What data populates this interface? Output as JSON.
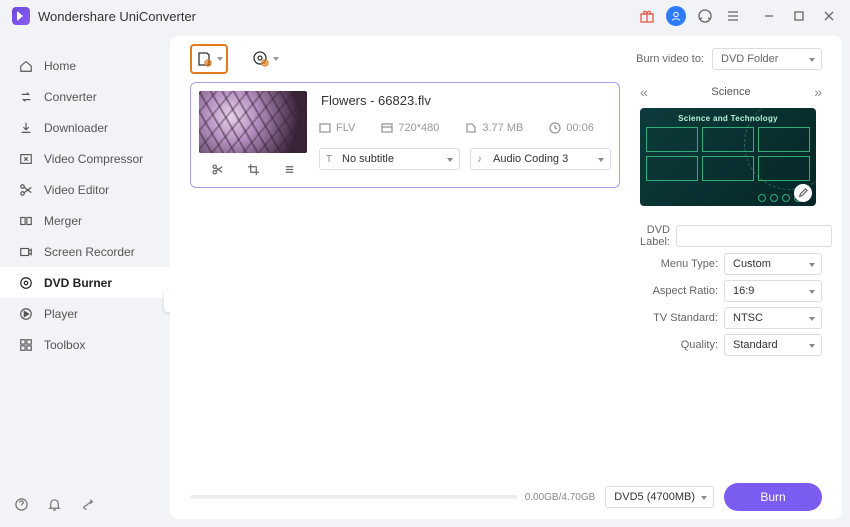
{
  "app": {
    "title": "Wondershare UniConverter"
  },
  "sidebar": {
    "items": [
      {
        "label": "Home"
      },
      {
        "label": "Converter"
      },
      {
        "label": "Downloader"
      },
      {
        "label": "Video Compressor"
      },
      {
        "label": "Video Editor"
      },
      {
        "label": "Merger"
      },
      {
        "label": "Screen Recorder"
      },
      {
        "label": "DVD Burner"
      },
      {
        "label": "Player"
      },
      {
        "label": "Toolbox"
      }
    ],
    "active_index": 7
  },
  "burn_to": {
    "label": "Burn video to:",
    "value": "DVD Folder"
  },
  "file": {
    "name": "Flowers - 66823.flv",
    "format": "FLV",
    "resolution": "720*480",
    "size": "3.77 MB",
    "duration": "00:06",
    "subtitle": "No subtitle",
    "audio": "Audio Coding 3"
  },
  "template": {
    "name": "Science",
    "banner": "Science and Technology"
  },
  "form": {
    "labels": {
      "dvd_label": "DVD Label:",
      "menu_type": "Menu Type:",
      "aspect": "Aspect Ratio:",
      "tv": "TV Standard:",
      "quality": "Quality:"
    },
    "dvd_label": "",
    "menu_type": "Custom",
    "aspect_ratio": "16:9",
    "tv_standard": "NTSC",
    "quality": "Standard"
  },
  "footer": {
    "progress_text": "0.00GB/4.70GB",
    "disc": "DVD5 (4700MB)",
    "burn_label": "Burn"
  }
}
